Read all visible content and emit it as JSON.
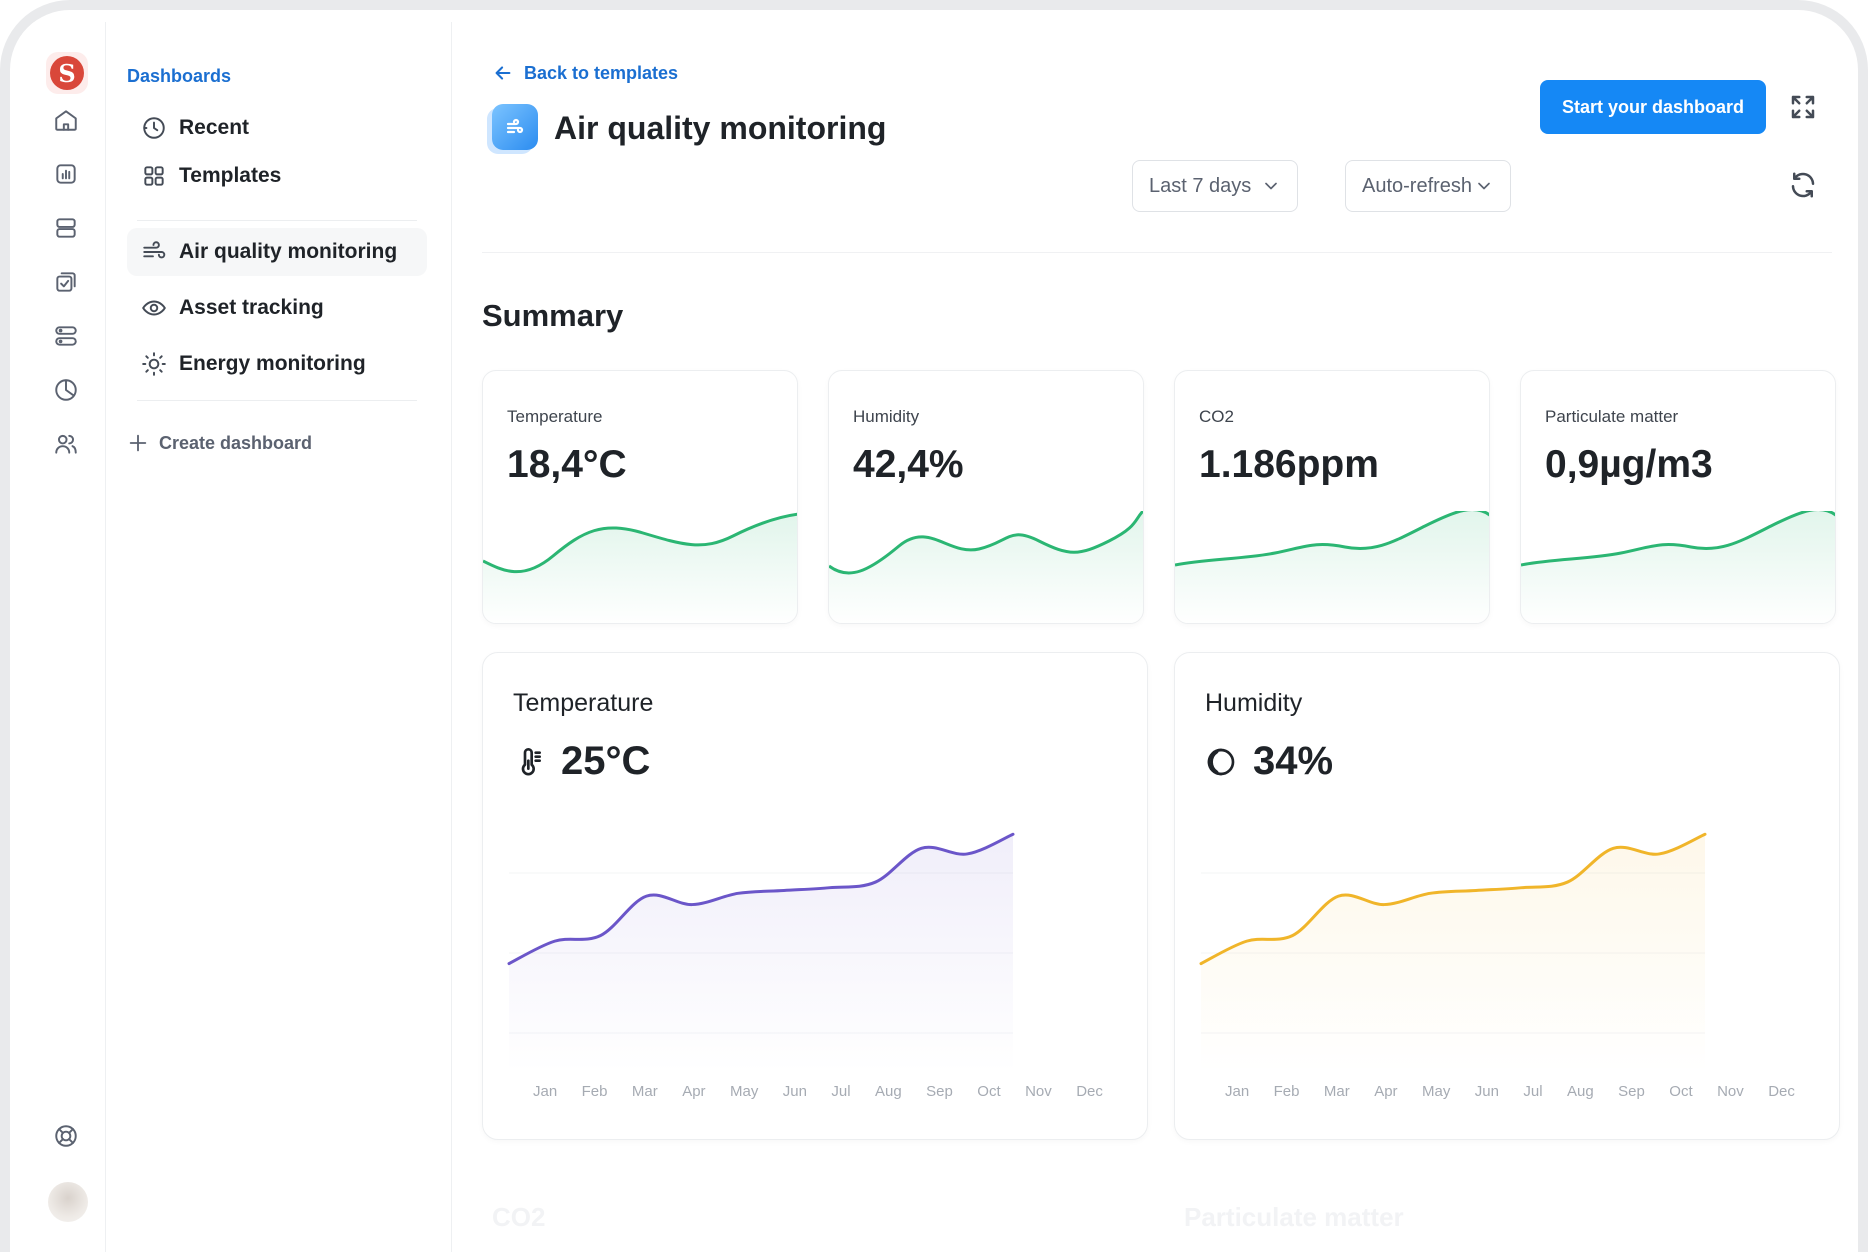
{
  "nav": {
    "heading": "Dashboards",
    "items": [
      {
        "label": "Recent",
        "icon": "clock-icon"
      },
      {
        "label": "Templates",
        "icon": "grid-icon"
      },
      {
        "label": "Air quality monitoring",
        "icon": "wind-icon",
        "active": true
      },
      {
        "label": "Asset tracking",
        "icon": "eye-icon"
      },
      {
        "label": "Energy monitoring",
        "icon": "sun-icon"
      }
    ],
    "create_label": "Create dashboard"
  },
  "header": {
    "back_label": "Back to templates",
    "title": "Air quality monitoring",
    "cta_label": "Start your dashboard",
    "range_select": "Last 7 days",
    "refresh_select": "Auto-refresh"
  },
  "summary": {
    "heading": "Summary",
    "cards": [
      {
        "label": "Temperature",
        "value": "18,4°C"
      },
      {
        "label": "Humidity",
        "value": "42,4%"
      },
      {
        "label": "CO2",
        "value": "1.186ppm"
      },
      {
        "label": "Particulate matter",
        "value": "0,9µg/m3"
      }
    ]
  },
  "charts": {
    "temperature": {
      "title": "Temperature",
      "value": "25°C"
    },
    "humidity": {
      "title": "Humidity",
      "value": "34%"
    },
    "ghost_titles": [
      "CO2",
      "Particulate matter"
    ]
  },
  "colors": {
    "accent": "#1588f5",
    "link": "#1b6fd1",
    "spark": "#2bb673",
    "temperature_line": "#6b56c9",
    "humidity_line": "#f0b52a"
  },
  "chart_data": [
    {
      "type": "line",
      "categories": [
        "Jan",
        "Feb",
        "Mar",
        "Apr",
        "May",
        "Jun",
        "Jul",
        "Aug",
        "Sep",
        "Oct",
        "Nov",
        "Dec"
      ],
      "series": [
        {
          "values": [
            14,
            22,
            24,
            38,
            35,
            39,
            40,
            41,
            43,
            55,
            53,
            60
          ]
        }
      ]
    },
    {
      "type": "line",
      "categories": [
        "Jan",
        "Feb",
        "Mar",
        "Apr",
        "May",
        "Jun",
        "Jul",
        "Aug",
        "Sep",
        "Oct",
        "Nov",
        "Dec"
      ],
      "series": [
        {
          "values": [
            14,
            22,
            24,
            38,
            35,
            39,
            40,
            41,
            43,
            55,
            53,
            60
          ]
        }
      ]
    }
  ]
}
